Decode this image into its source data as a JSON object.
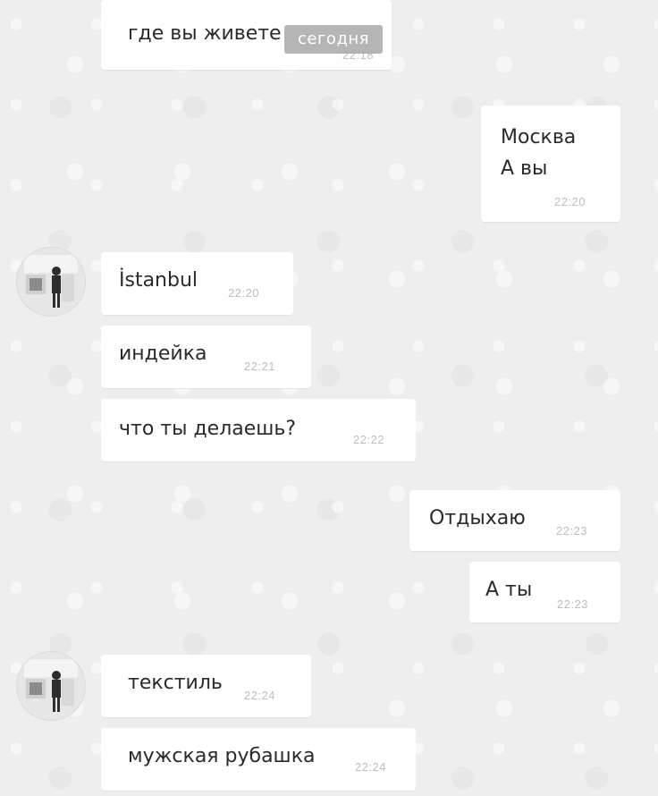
{
  "date_separator": "сегодня",
  "messages": [
    {
      "side": "in",
      "text": "где вы живете",
      "time": "22:18"
    },
    {
      "side": "out",
      "lines": [
        "Москва",
        "А вы"
      ],
      "time": "22:20"
    },
    {
      "side": "in",
      "text": "İstanbul",
      "time": "22:20"
    },
    {
      "side": "in",
      "text": "индейка",
      "time": "22:21"
    },
    {
      "side": "in",
      "text": "что ты делаешь?",
      "time": "22:22"
    },
    {
      "side": "out",
      "text": "Отдыхаю",
      "time": "22:23"
    },
    {
      "side": "out",
      "text": "А ты",
      "time": "22:23"
    },
    {
      "side": "in",
      "text": "текстиль",
      "time": "22:24"
    },
    {
      "side": "in",
      "text": "мужская рубашка",
      "time": "22:24"
    }
  ],
  "avatar_icon": "contact-photo-icon",
  "colors": {
    "bubble": "#ffffff",
    "background": "#eeeeee",
    "time": "#bdbdbd",
    "date_chip": "#a8a8a8"
  }
}
